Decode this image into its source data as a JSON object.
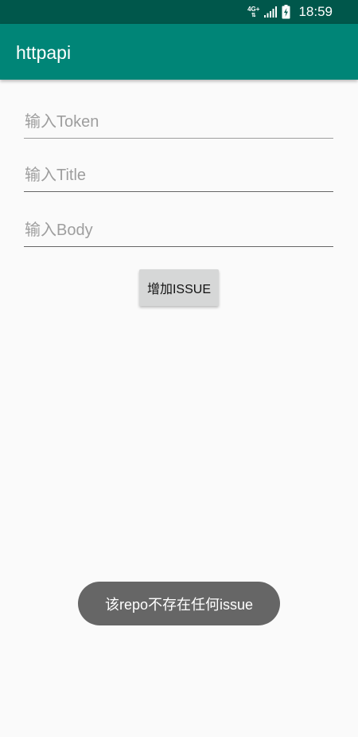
{
  "status_bar": {
    "network_type": "4G+",
    "network_arrows": "⇅",
    "time": "18:59",
    "background": "#00574b"
  },
  "app_bar": {
    "title": "httpapi",
    "background": "#008577"
  },
  "form": {
    "token": {
      "placeholder": "输入Token",
      "value": ""
    },
    "title": {
      "placeholder": "输入Title",
      "value": ""
    },
    "body": {
      "placeholder": "输入Body",
      "value": ""
    },
    "submit_label": "增加ISSUE"
  },
  "toast": {
    "message": "该repo不存在任何issue"
  }
}
